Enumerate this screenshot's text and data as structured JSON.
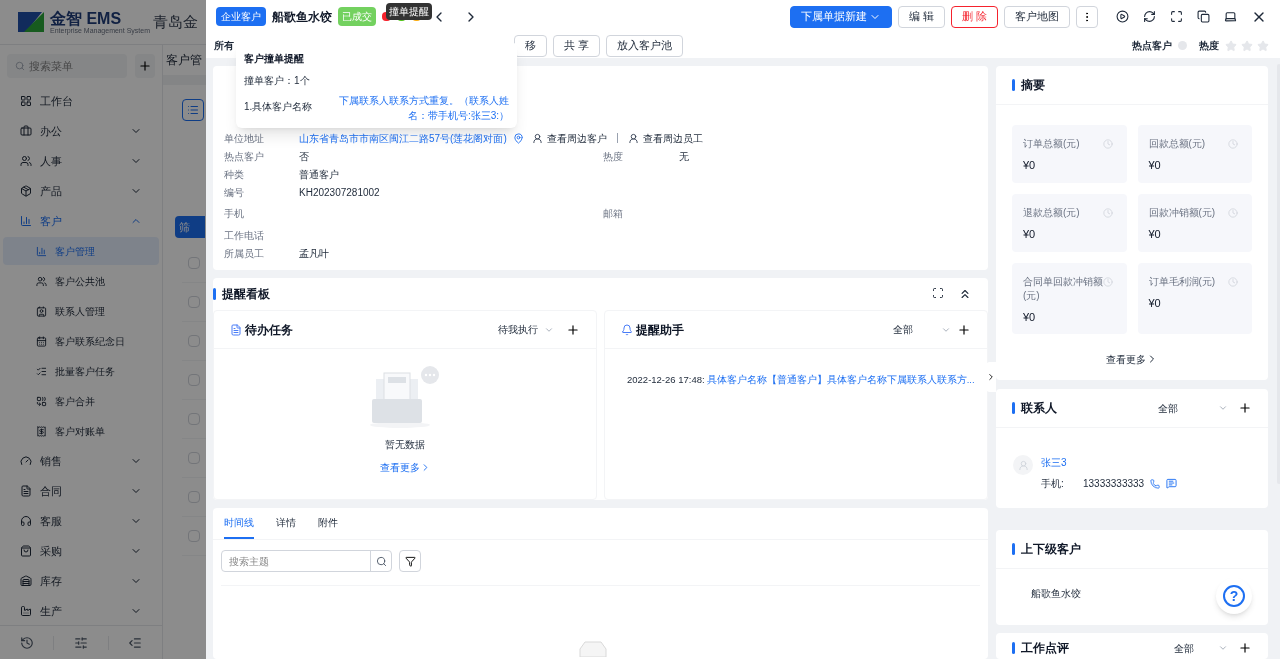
{
  "app": {
    "logo": {
      "name": "金智 EMS",
      "tagline": "Enterprise Management System"
    },
    "company": "青岛金",
    "search": {
      "placeholder": "搜索菜单"
    },
    "menu": [
      {
        "label": "工作台",
        "kind": "page",
        "expanded": false
      },
      {
        "label": "办公",
        "kind": "group",
        "expanded": false
      },
      {
        "label": "人事",
        "kind": "group",
        "expanded": false
      },
      {
        "label": "产品",
        "kind": "group",
        "expanded": false
      },
      {
        "label": "客户",
        "kind": "group",
        "expanded": true,
        "children": [
          {
            "label": "客户管理",
            "selected": true
          },
          {
            "label": "客户公共池",
            "selected": false
          },
          {
            "label": "联系人管理",
            "selected": false
          },
          {
            "label": "客户联系纪念日",
            "selected": false
          },
          {
            "label": "批量客户任务",
            "selected": false
          },
          {
            "label": "客户合并",
            "selected": false
          },
          {
            "label": "客户对账单",
            "selected": false
          }
        ]
      },
      {
        "label": "销售",
        "kind": "group",
        "expanded": false
      },
      {
        "label": "合同",
        "kind": "group",
        "expanded": false
      },
      {
        "label": "客服",
        "kind": "group",
        "expanded": false
      },
      {
        "label": "采购",
        "kind": "group",
        "expanded": false
      },
      {
        "label": "库存",
        "kind": "group",
        "expanded": false
      },
      {
        "label": "生产",
        "kind": "group",
        "expanded": false
      }
    ],
    "page_title": "客户管",
    "filter_button": "筛",
    "rows": [
      {
        "checked": false
      },
      {
        "checked": false
      },
      {
        "checked": false
      },
      {
        "checked": false
      },
      {
        "checked": false
      },
      {
        "checked": false
      },
      {
        "checked": false
      },
      {
        "checked": false
      }
    ]
  },
  "drawer": {
    "type_tag": "企业客户",
    "name": "船歌鱼水饺",
    "status": "已成交",
    "flags": [
      {
        "color": "#f5222d"
      },
      {
        "color": "#52c41a"
      },
      {
        "color": "#faad14"
      }
    ],
    "tooltip": "撞单提醒",
    "actions": [
      {
        "label": "下属单据新建",
        "kind": "primary"
      },
      {
        "label": "编 辑",
        "kind": "default"
      },
      {
        "label": "删 除",
        "kind": "danger"
      },
      {
        "label": "客户地图",
        "kind": "default"
      }
    ],
    "toolbar": {
      "owner_label": "所有",
      "buttons": [
        "移",
        "共 享",
        "放入客户池"
      ],
      "hot_label": "热点客户",
      "hot": false,
      "heat_label": "热度",
      "stars": 0
    },
    "popover": {
      "title": "客户撞单提醒",
      "count": "撞单客户：1个",
      "items": [
        {
          "name": "1.具体客户名称",
          "detail": "下属联系人联系方式重复。（联系人姓名：带手机号:张三3:）"
        }
      ]
    },
    "info": {
      "address": {
        "label": "单位地址",
        "value": "山东省青岛市市南区闽江二路57号(莲花阁对面)",
        "nearby_customers": "查看周边客户",
        "nearby_staff": "查看周边员工"
      },
      "rows": [
        {
          "label": "热点客户",
          "value": "否",
          "label2": "热度",
          "value2": "无"
        },
        {
          "label": "种类",
          "value": "普通客户"
        },
        {
          "label": "编号",
          "value": "KH202307281002"
        },
        {
          "label": "手机",
          "label2": "邮箱"
        },
        {
          "label": "工作电话"
        },
        {
          "label": "所属员工",
          "value": "孟凡叶"
        }
      ]
    },
    "board": {
      "title": "提醒看板",
      "tasks": {
        "title": "待办任务",
        "filter": "待我执行",
        "empty": "暂无数据",
        "more": "查看更多"
      },
      "assistant": {
        "title": "提醒助手",
        "filter": "全部",
        "items": [
          {
            "time": "2022-12-26 17:48:",
            "text": "具体客户名称【普通客户】具体客户名称下属联系人联系方..."
          }
        ]
      }
    },
    "timeline": {
      "tabs": [
        {
          "label": "时间线",
          "selected": true
        },
        {
          "label": "详情",
          "selected": false
        },
        {
          "label": "附件",
          "selected": false
        }
      ],
      "search": {
        "placeholder": "搜索主题"
      }
    },
    "summary": {
      "title": "摘要",
      "stats": [
        {
          "label": "订单总额(元)",
          "value": "¥0"
        },
        {
          "label": "回款总额(元)",
          "value": "¥0"
        },
        {
          "label": "退款总额(元)",
          "value": "¥0"
        },
        {
          "label": "回款冲销额(元)",
          "value": "¥0"
        },
        {
          "label": "合同单回款冲销额(元)",
          "value": "¥0"
        },
        {
          "label": "订单毛利润(元)",
          "value": "¥0"
        }
      ],
      "more": "查看更多"
    },
    "contacts": {
      "title": "联系人",
      "filter": "全部",
      "items": [
        {
          "name": "张三3",
          "phone_label": "手机:",
          "phone": "13333333333"
        }
      ]
    },
    "relations": {
      "title": "上下级客户",
      "items": [
        "船歌鱼水饺"
      ]
    },
    "comments": {
      "title": "工作点评",
      "filter": "全部"
    },
    "help": "?"
  }
}
